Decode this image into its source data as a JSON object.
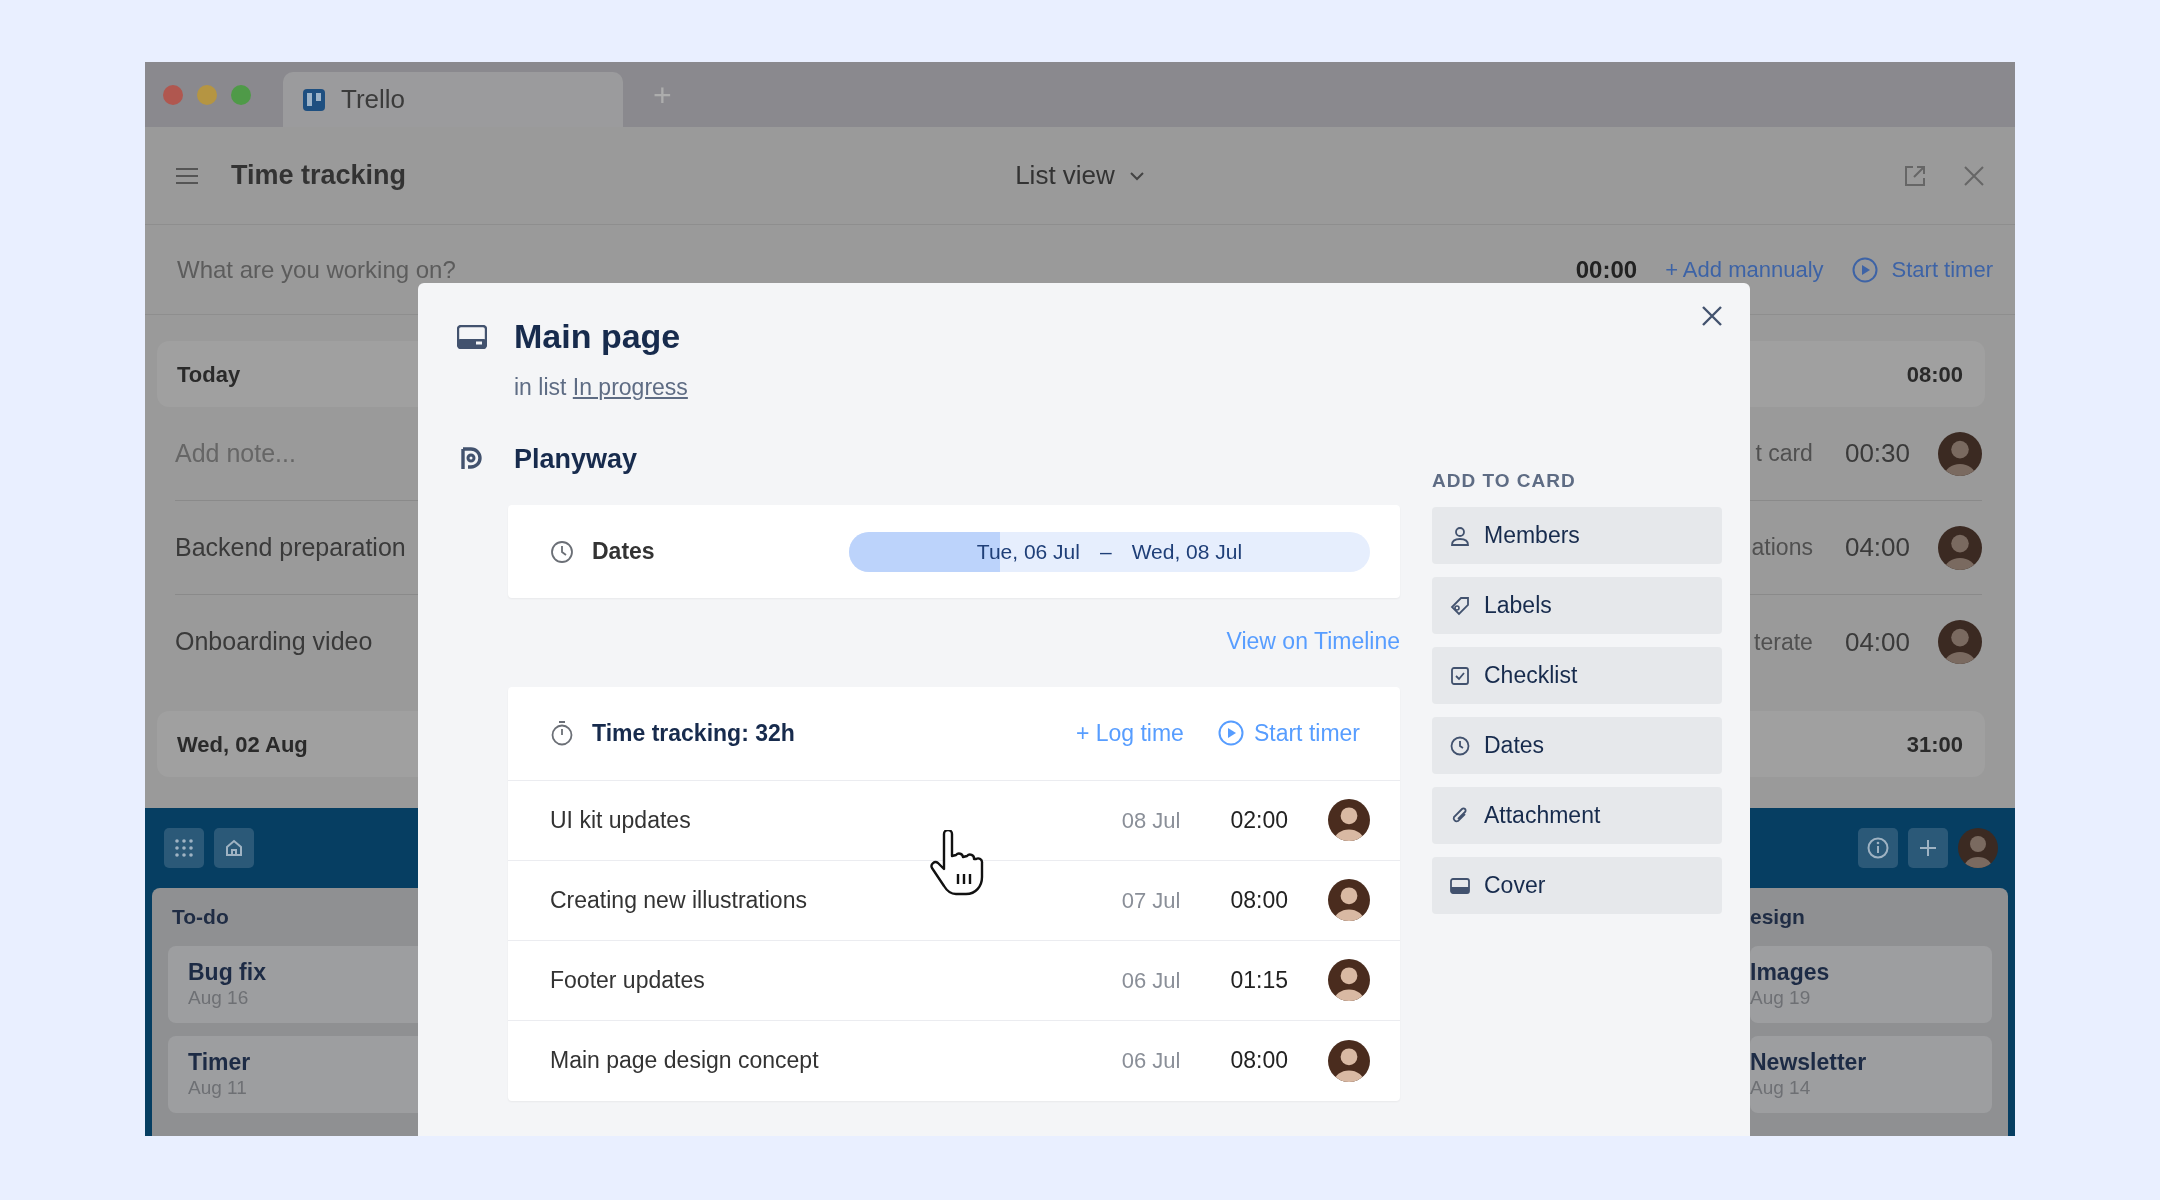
{
  "browser": {
    "tab_title": "Trello",
    "new_tab": "+"
  },
  "header": {
    "title": "Time tracking",
    "view": "List view"
  },
  "timer_bar": {
    "placeholder": "What are you working on?",
    "time": "00:00",
    "add_manually": "+ Add mannualy",
    "start": "Start timer"
  },
  "groups": [
    {
      "label": "Today",
      "total": "08:00",
      "entries": [
        {
          "kind": "note",
          "placeholder": "Add note...",
          "task": "t card",
          "time": "00:30"
        },
        {
          "kind": "entry",
          "description": "Backend preparation",
          "task": "ations",
          "time": "04:00"
        },
        {
          "kind": "entry",
          "description": "Onboarding video",
          "task": "terate",
          "time": "04:00"
        }
      ]
    },
    {
      "label": "Wed, 02 Aug",
      "total": "31:00"
    }
  ],
  "board": {
    "lists": [
      {
        "title": "To-do",
        "cards": [
          {
            "title": "Bug fix",
            "date": "Aug 16"
          },
          {
            "title": "Timer",
            "date": "Aug 11"
          }
        ]
      },
      {
        "title": "esign",
        "cards": [
          {
            "title": "Images",
            "date": "Aug 19"
          },
          {
            "title": "Newsletter",
            "date": "Aug 14"
          }
        ]
      }
    ]
  },
  "modal": {
    "title": "Main page",
    "list_prefix": "in list",
    "list_name": "In progress",
    "section": "Planyway",
    "dates": {
      "label": "Dates",
      "start": "Tue, 06 Jul",
      "separator": "–",
      "end": "Wed, 08 Jul",
      "level": 0.29
    },
    "timeline_link": "View on Timeline",
    "time_tracking": {
      "title": "Time tracking: 32h",
      "log": "+ Log time",
      "start": "Start timer",
      "rows": [
        {
          "task": "UI kit updates",
          "date": "08 Jul",
          "time": "02:00"
        },
        {
          "task": "Creating new illustrations",
          "date": "07 Jul",
          "time": "08:00"
        },
        {
          "task": "Footer updates",
          "date": "06 Jul",
          "time": "01:15"
        },
        {
          "task": "Main page design concept",
          "date": "06 Jul",
          "time": "08:00"
        }
      ]
    },
    "add_to_card": {
      "heading": "ADD TO CARD",
      "items": [
        {
          "kind": "members",
          "label": "Members"
        },
        {
          "kind": "labels",
          "label": "Labels"
        },
        {
          "kind": "checklist",
          "label": "Checklist"
        },
        {
          "kind": "dates",
          "label": "Dates"
        },
        {
          "kind": "attachment",
          "label": "Attachment"
        },
        {
          "kind": "cover",
          "label": "Cover"
        }
      ]
    }
  }
}
